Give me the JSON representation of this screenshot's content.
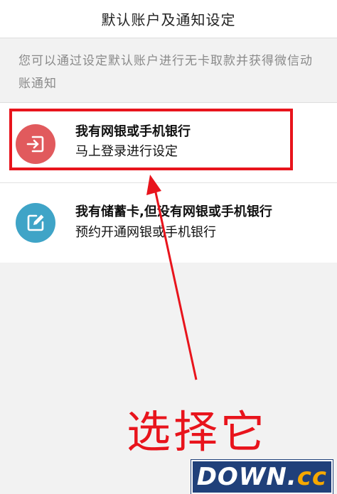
{
  "header": {
    "title": "默认账户及通知设定"
  },
  "description": "您可以通过设定默认账户进行无卡取款并获得微信动账通知",
  "options": [
    {
      "title": "我有网银或手机银行",
      "subtitle": "马上登录进行设定",
      "icon": "login-enter-icon",
      "icon_color": "#e15a5d"
    },
    {
      "title": "我有储蓄卡,但没有网银或手机银行",
      "subtitle": "预约开通网银或手机银行",
      "icon": "edit-pencil-icon",
      "icon_color": "#3fa4c7"
    }
  ],
  "annotation": {
    "callout": "选择它",
    "color": "#e8141c"
  },
  "watermark": {
    "main": "DOWN.",
    "accent": "cc"
  }
}
